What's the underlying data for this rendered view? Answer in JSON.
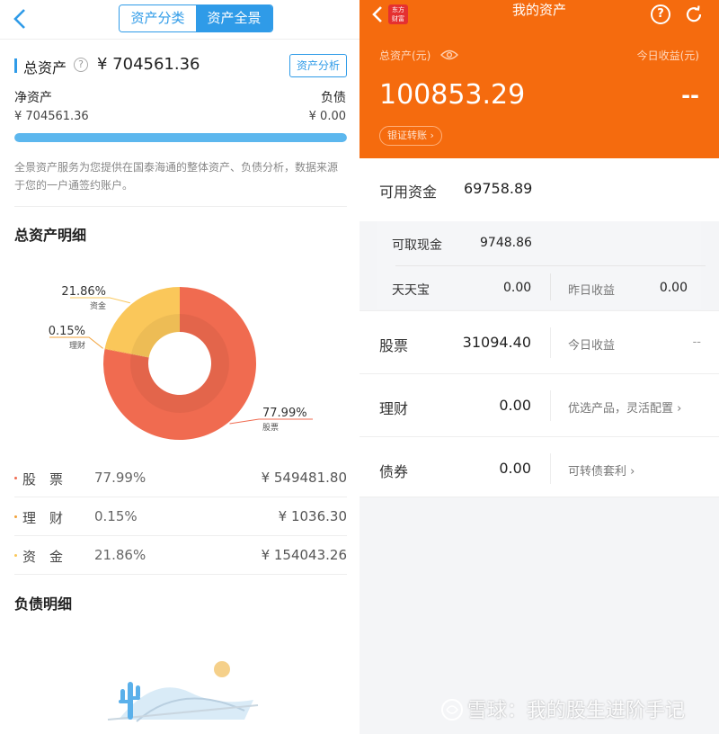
{
  "left": {
    "tabs": [
      "资产分类",
      "资产全景"
    ],
    "active_tab": "资产全景",
    "total": {
      "label": "总资产",
      "value": "¥ 704561.36",
      "analyze_button": "资产分析"
    },
    "net": {
      "label": "净资产",
      "value": "¥ 704561.36"
    },
    "debt": {
      "label": "负债",
      "value": "¥ 0.00"
    },
    "net_ratio": 1.0,
    "description": "全景资产服务为您提供在国泰海通的整体资产、负债分析，数据来源于您的一户通签约账户。",
    "detail_title": "总资产明细",
    "liability_title": "负债明细",
    "chart_data": {
      "type": "pie",
      "slices": [
        {
          "label": "股票",
          "percent_label": "77.99%",
          "value": 77.99,
          "color": "#f06b50"
        },
        {
          "label": "理财",
          "percent_label": "0.15%",
          "value": 0.15,
          "color": "#f2a23a"
        },
        {
          "label": "资金",
          "percent_label": "21.86%",
          "value": 21.86,
          "color": "#fac75a"
        }
      ]
    },
    "legend": [
      {
        "name": "股　票",
        "pct": "77.99%",
        "amount": "¥ 549481.80",
        "color": "#f06b50"
      },
      {
        "name": "理　财",
        "pct": "0.15%",
        "amount": "¥ 1036.30",
        "color": "#f2a23a"
      },
      {
        "name": "资　金",
        "pct": "21.86%",
        "amount": "¥ 154043.26",
        "color": "#fac75a"
      }
    ]
  },
  "right": {
    "title": "我的资产",
    "brand": "东方财富",
    "total_label": "总资产(元)",
    "total_value": "100853.29",
    "today_label": "今日收益(元)",
    "today_value": "--",
    "transfer_button": "银证转账 ›",
    "available": {
      "label": "可用资金",
      "value": "69758.89"
    },
    "cash": {
      "label": "可取现金",
      "value": "9748.86"
    },
    "tiantianbao": {
      "label": "天天宝",
      "value": "0.00",
      "right_label": "昨日收益",
      "right_value": "0.00"
    },
    "rows": [
      {
        "label": "股票",
        "value": "31094.40",
        "right_label": "今日收益",
        "right_value": "--"
      },
      {
        "label": "理财",
        "value": "0.00",
        "right_label": "优选产品，灵活配置 ›",
        "right_value": ""
      },
      {
        "label": "债券",
        "value": "0.00",
        "right_label": "可转债套利 ›",
        "right_value": ""
      }
    ]
  },
  "watermark": "雪球：我的股生进阶手记"
}
